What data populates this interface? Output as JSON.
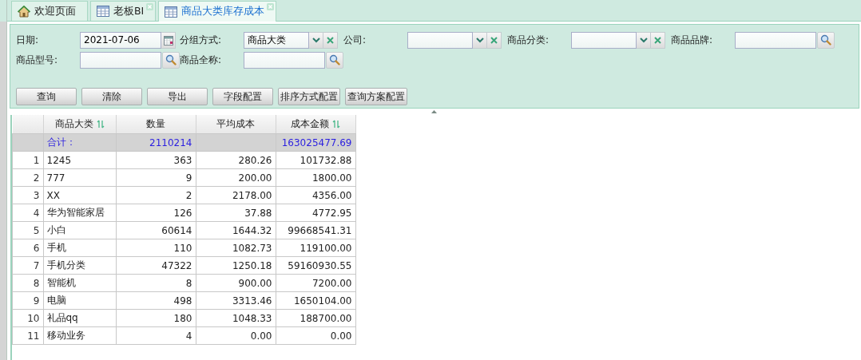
{
  "tabs": [
    {
      "label": "欢迎页面",
      "kind": "home",
      "closable": false,
      "selected": false
    },
    {
      "label": "老板BI",
      "kind": "report",
      "closable": true,
      "selected": false
    },
    {
      "label": "商品大类库存成本",
      "kind": "report",
      "closable": true,
      "selected": true
    }
  ],
  "filters": [
    {
      "label": "日期:",
      "kind": "date",
      "value": "2021-07-06"
    },
    {
      "label": "分组方式:",
      "kind": "combo",
      "value": "商品大类"
    },
    {
      "label": "公司:",
      "kind": "combo"
    },
    {
      "label": "商品分类:",
      "kind": "combo"
    },
    {
      "label": "商品品牌:",
      "kind": "lookup"
    },
    {
      "label": "商品型号:",
      "kind": "lookup"
    },
    {
      "label": "商品全称:",
      "kind": "lookup"
    }
  ],
  "buttons": [
    "查询",
    "清除",
    "导出",
    "字段配置",
    "排序方式配置",
    "查询方案配置"
  ],
  "table": {
    "columns": [
      {
        "label": "商品大类",
        "sortable": true
      },
      {
        "label": "数量",
        "sortable": false
      },
      {
        "label": "平均成本",
        "sortable": false
      },
      {
        "label": "成本金额",
        "sortable": true
      }
    ],
    "total": {
      "label": "合计：",
      "cells": [
        "2110214",
        "",
        "163025477.69"
      ]
    },
    "rows": [
      {
        "num": "1",
        "cells": [
          "1245",
          "363",
          "280.26",
          "101732.88"
        ]
      },
      {
        "num": "2",
        "cells": [
          "777",
          "9",
          "200.00",
          "1800.00"
        ]
      },
      {
        "num": "3",
        "cells": [
          "XX",
          "2",
          "2178.00",
          "4356.00"
        ]
      },
      {
        "num": "4",
        "cells": [
          "华为智能家居",
          "126",
          "37.88",
          "4772.95"
        ]
      },
      {
        "num": "5",
        "cells": [
          "小白",
          "60614",
          "1644.32",
          "99668541.31"
        ]
      },
      {
        "num": "6",
        "cells": [
          "手机",
          "110",
          "1082.73",
          "119100.00"
        ]
      },
      {
        "num": "7",
        "cells": [
          "手机分类",
          "47322",
          "1250.18",
          "59160930.55"
        ]
      },
      {
        "num": "8",
        "cells": [
          "智能机",
          "8",
          "900.00",
          "7200.00"
        ]
      },
      {
        "num": "9",
        "cells": [
          "电脑",
          "498",
          "3313.46",
          "1650104.00"
        ]
      },
      {
        "num": "10",
        "cells": [
          "礼品qq",
          "180",
          "1048.33",
          "188700.00"
        ]
      },
      {
        "num": "11",
        "cells": [
          "移动业务",
          "4",
          "0.00",
          "0.00"
        ]
      }
    ]
  }
}
